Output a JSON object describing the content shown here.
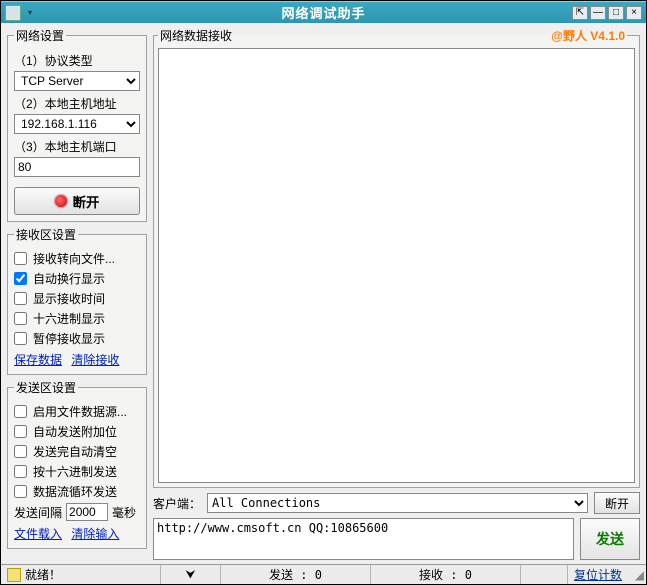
{
  "title": "网络调试助手",
  "version_label": "@野人  V4.1.0",
  "titlebar_buttons": {
    "pin": "⇱",
    "min": "—",
    "max": "□",
    "close": "×"
  },
  "net": {
    "legend": "网络设置",
    "protocol_label": "（1）协议类型",
    "protocol_value": "TCP Server",
    "host_label": "（2）本地主机地址",
    "host_value": "192.168.1.116",
    "port_label": "（3）本地主机端口",
    "port_value": "80",
    "disconnect_label": "断开"
  },
  "recv": {
    "legend": "接收区设置",
    "c1": {
      "label": "接收转向文件...",
      "checked": false
    },
    "c2": {
      "label": "自动换行显示",
      "checked": true
    },
    "c3": {
      "label": "显示接收时间",
      "checked": false
    },
    "c4": {
      "label": "十六进制显示",
      "checked": false
    },
    "c5": {
      "label": "暂停接收显示",
      "checked": false
    },
    "save_link": "保存数据",
    "clear_link": "清除接收"
  },
  "send": {
    "legend": "发送区设置",
    "c1": {
      "label": "启用文件数据源...",
      "checked": false
    },
    "c2": {
      "label": "自动发送附加位",
      "checked": false
    },
    "c3": {
      "label": "发送完自动清空",
      "checked": false
    },
    "c4": {
      "label": "按十六进制发送",
      "checked": false
    },
    "c5": {
      "label": "数据流循环发送",
      "checked": false
    },
    "interval_label_pre": "发送间隔",
    "interval_value": "2000",
    "interval_label_post": "毫秒",
    "load_link": "文件载入",
    "clear_link": "清除输入"
  },
  "main": {
    "recv_legend": "网络数据接收",
    "client_label": "客户端：",
    "client_value": "All Connections",
    "client_disconnect": "断开",
    "send_text": "http://www.cmsoft.cn QQ:10865600",
    "send_button": "发送"
  },
  "status": {
    "ready": "就绪！",
    "send_label": "发送 : 0",
    "recv_label": "接收 : 0",
    "reset_label": "复位计数"
  }
}
